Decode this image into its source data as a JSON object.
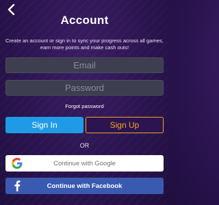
{
  "header": {
    "title": "Account",
    "subtitle": "Create an account or sign in to sync your progress across all games, earn more points and make cash outs!"
  },
  "form": {
    "email_placeholder": "Email",
    "password_placeholder": "Password",
    "forgot_label": "Forgot password"
  },
  "actions": {
    "signin_label": "Sign In",
    "signup_label": "Sign Up",
    "or_label": "OR"
  },
  "social": {
    "google_label": "Continue with Google",
    "facebook_label": "Continue with Facebook"
  },
  "icons": {
    "back": "chevron-left-icon",
    "google": "google-icon",
    "facebook": "facebook-icon"
  },
  "colors": {
    "background": "#2b1450",
    "signin": "#1f9be6",
    "signup_accent": "#f6a623",
    "facebook": "#3a5ab2",
    "input": "#3d3e50"
  }
}
